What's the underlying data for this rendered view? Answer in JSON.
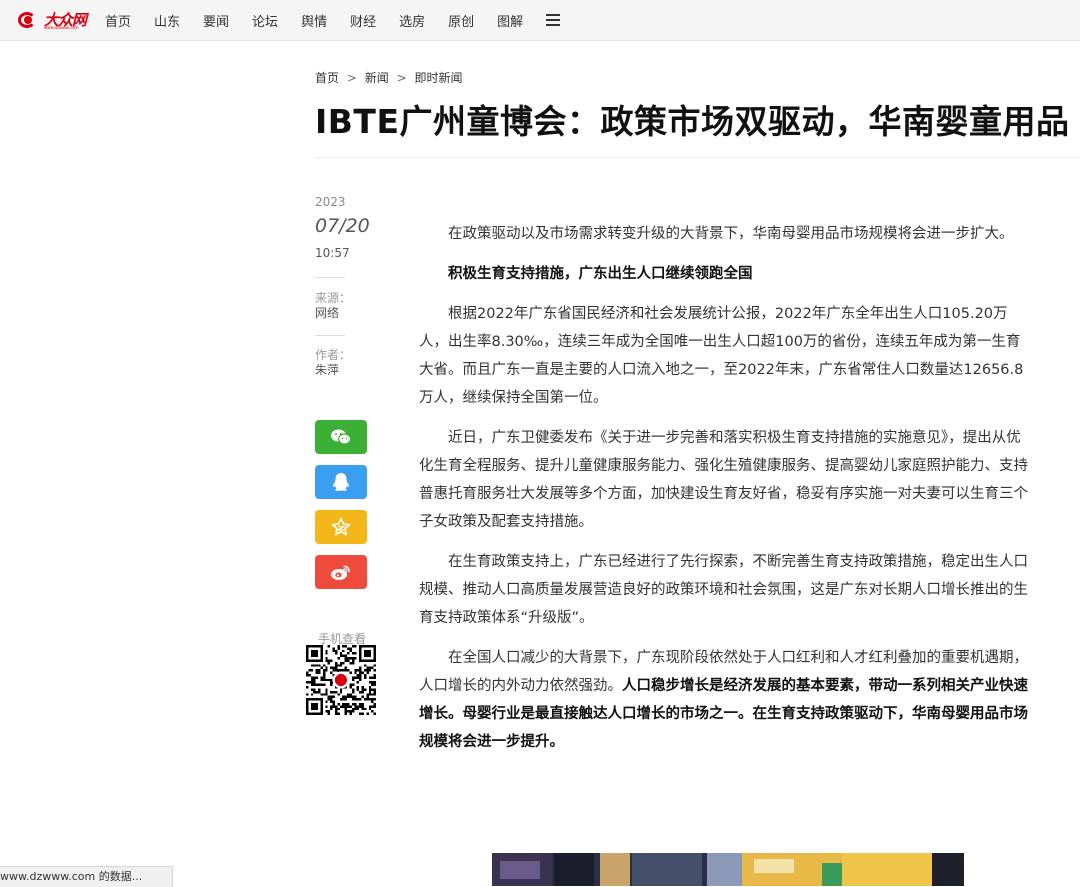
{
  "nav": {
    "logo_text": "大众网",
    "logo_sub": "www.dzwww.com",
    "items": [
      "首页",
      "山东",
      "要闻",
      "论坛",
      "舆情",
      "财经",
      "选房",
      "原创",
      "图解"
    ]
  },
  "breadcrumb": [
    "首页",
    "新闻",
    "即时新闻"
  ],
  "breadcrumb_sep": ">",
  "title": "IBTE广州童博会：政策市场双驱动，华南婴童用品",
  "meta": {
    "year": "2023",
    "date": "07/20",
    "time": "10:57",
    "source_label": "来源：",
    "source": "网络",
    "author_label": "作者：",
    "author": "朱萍"
  },
  "share": {
    "colors": {
      "wechat": "#3cb035",
      "qq": "#3a9ff0",
      "qzone": "#f3b719",
      "weibo": "#ef4b3d"
    },
    "icons": [
      "wechat-icon",
      "qq-icon",
      "qzone-icon",
      "weibo-icon"
    ]
  },
  "qr": {
    "label": "手机查看"
  },
  "article": {
    "p1": "在政策驱动以及市场需求转变升级的大背景下，华南母婴用品市场规模将会进一步扩大。",
    "h1": "积极生育支持措施，广东出生人口继续领跑全国",
    "p2": "根据2022年广东省国民经济和社会发展统计公报，2022年广东全年出生人口105.20万人，出生率8.30‰，连续三年成为全国唯一出生人口超100万的省份，连续五年成为第一生育大省。而且广东一直是主要的人口流入地之一，至2022年末，广东省常住人口数量达12656.8万人，继续保持全国第一位。",
    "p3": "近日，广东卫健委发布《关于进一步完善和落实积极生育支持措施的实施意见》，提出从优化生育全程服务、提升儿童健康服务能力、强化生殖健康服务、提高婴幼儿家庭照护能力、支持普惠托育服务壮大发展等多个方面，加快建设生育友好省，稳妥有序实施一对夫妻可以生育三个子女政策及配套支持措施。",
    "p4": "在生育政策支持上，广东已经进行了先行探索，不断完善生育支持政策措施，稳定出生人口规模、推动人口高质量发展营造良好的政策环境和社会氛围，这是广东对长期人口增长推出的生育支持政策体系“升级版”。",
    "p5_normal": "在全国人口减少的大背景下，广东现阶段依然处于人口红利和人才红利叠加的重要机遇期，人口增长的内外动力依然强劲。",
    "p5_bold": "人口稳步增长是经济发展的基本要素，带动一系列相关产业快速增长。母婴行业是最直接触达人口增长的市场之一。在生育支持政策驱动下，华南母婴用品市场规模将会进一步提升。"
  },
  "status_text": "www.dzwww.com 的数据..."
}
